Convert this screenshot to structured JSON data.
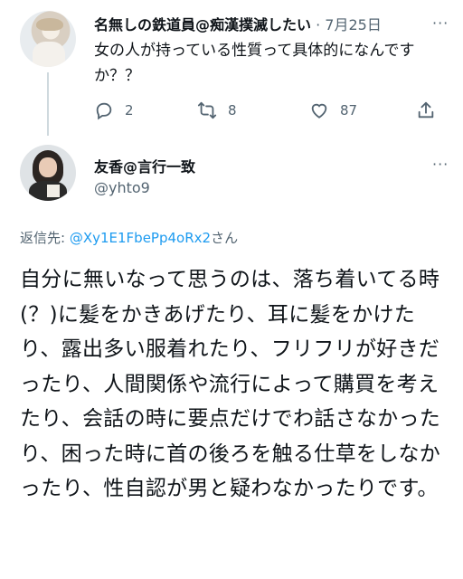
{
  "tweet1": {
    "display_name": "名無しの鉄道員@痴漢撲滅したい",
    "date": "· 7月25日",
    "more_icon": "more-horizontal-icon",
    "text": "女の人が持っている性質って具体的になんですか？？",
    "actions": {
      "reply_count": "2",
      "retweet_count": "8",
      "like_count": "87"
    }
  },
  "tweet2": {
    "display_name": "友香@言行一致",
    "handle": "@yhto9",
    "more_icon": "more-horizontal-icon",
    "replying_prefix": "返信先: ",
    "replying_mention": "@Xy1E1FbePp4oRx2",
    "replying_suffix": "さん",
    "text": "自分に無いなって思うのは、落ち着いてる時(？)に髪をかきあげたり、耳に髪をかけたり、露出多い服着れたり、フリフリが好きだったり、人間関係や流行によって購買を考えたり、会話の時に要点だけでわ話さなかったり、困った時に首の後ろを触る仕草をしなかったり、性自認が男と疑わなかったりです。"
  },
  "colors": {
    "text": "#0f1419",
    "secondary": "#536471",
    "accent": "#1d9bf0",
    "thread_line": "#cfd9de"
  }
}
